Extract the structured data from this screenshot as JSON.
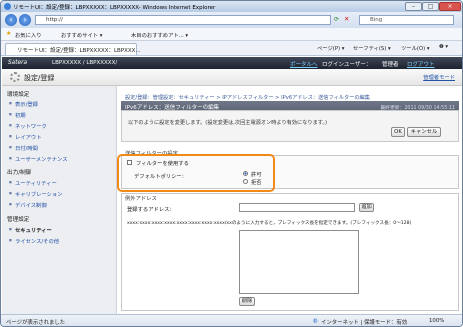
{
  "window": {
    "title": "リモートUI：設定/登録：LBPXXXXX：LBPXXXXX- Windows Internet Explorer",
    "url": "http://",
    "search_placeholder": "Bing",
    "buttons": [
      "–",
      "□",
      "×"
    ]
  },
  "favorites": {
    "label": "お気に入り",
    "item1": "おすすめサイト ▾",
    "item2": "木目のおすすめアト... ▾"
  },
  "tab": {
    "label": "リモートUI：設定/登録：LBPXXXXX：LBPXXX..."
  },
  "toolbar": {
    "page": "ページ(P) ▾",
    "safety": "セーフティ(S) ▾",
    "tools": "ツール(O) ▾",
    "help": "❷ ▾"
  },
  "site": {
    "logo": "Satera",
    "device": "LBPXXXXX / LBPXXXXX/",
    "portal_link": "ポータルへ",
    "login_user": "ログインユーザー：",
    "admin": "管理者",
    "logout": "ログアウト"
  },
  "page": {
    "title": "設定/登録",
    "mode_link": "管理者モード"
  },
  "sidebar": {
    "sections": [
      {
        "label": "環境設定",
        "items": [
          {
            "label": "表示/登録"
          },
          {
            "label": "初期"
          },
          {
            "label": "ネットワーク"
          },
          {
            "label": "レイアウト"
          },
          {
            "label": "日付/時間"
          },
          {
            "label": "ユーザーメンテナンス"
          }
        ]
      },
      {
        "label": "出力/制御",
        "items": [
          {
            "label": "ユーティリティー"
          },
          {
            "label": "キャリブレーション"
          },
          {
            "label": "デバイス制御"
          }
        ]
      },
      {
        "label": "管理設定",
        "items": [
          {
            "label": "セキュリティー"
          },
          {
            "label": "ライセンス/その他"
          }
        ]
      }
    ]
  },
  "main": {
    "breadcrumb": "設定/登録：管理設定：セキュリティー > IPアドレスフィルター > IPv6アドレス：送信フィルターの編集",
    "panel_title": "IPv6アドレス：送信フィルターの編集",
    "last_updated": "最終更新：2011 09/30 14:55:11",
    "message": "以下のように設定を変更します。(設定変更は,次回主電源オン時より有効になります。)",
    "ok": "OK",
    "cancel": "キャンセル",
    "filter_section": "送信フィルターの設定",
    "use_filter": "フィルターを使用する",
    "default_policy": "デフォルトポリシー：",
    "allow": "許可",
    "deny": "拒否",
    "exception_section": "例外アドレス",
    "register_address": "登録するアドレス：",
    "add": "追加",
    "note": "xxxx:xxxx:xxxx:xxxx:xxxx:xxxx:xxxx:xxxx/xxのように入力すると，プレフィックス長を指定できます。(プレフィックス長：0〜128)",
    "delete": "削除"
  },
  "status": {
    "left": "ページが表示されました",
    "zone": "インターネット | 保護モード：有効",
    "zoom": "100%"
  }
}
